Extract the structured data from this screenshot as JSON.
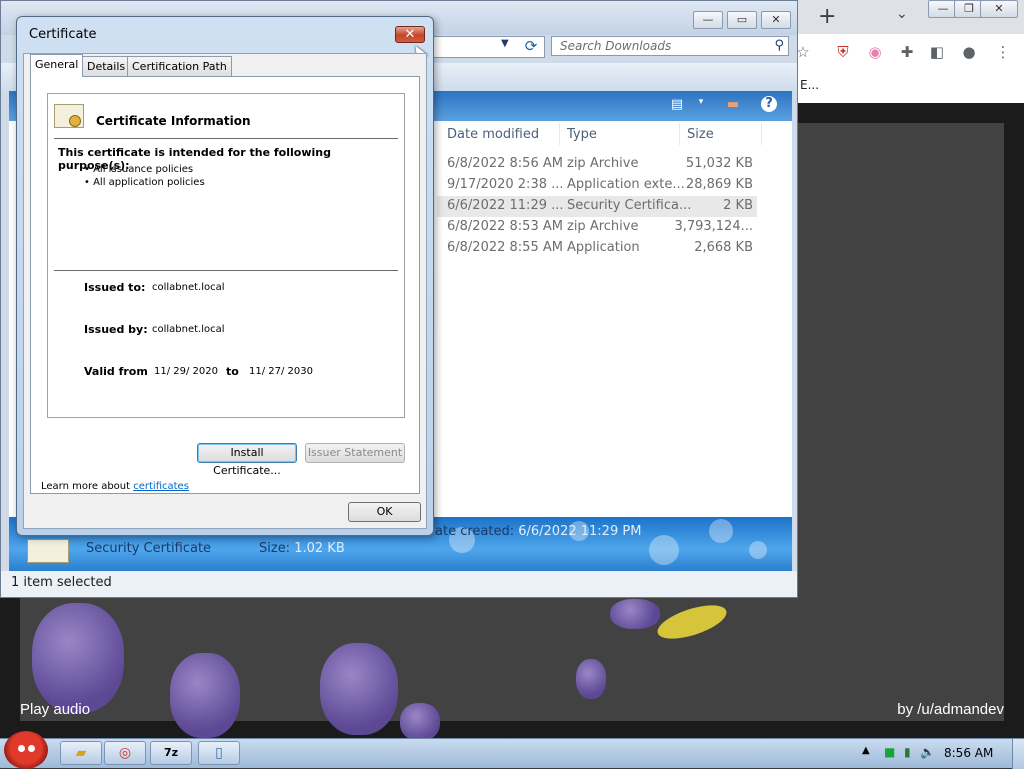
{
  "video": {
    "play_label": "Play audio",
    "credit": "by /u/admandev"
  },
  "browser": {
    "new_tab_glyph": "+",
    "tabs_dropdown_glyph": "⌄",
    "bookmark_fragment": "E..."
  },
  "explorer": {
    "search_placeholder": "Search Downloads",
    "columns": [
      "Date modified",
      "Type",
      "Size"
    ],
    "rows": [
      {
        "date": "6/8/2022 8:56 AM",
        "type": "zip Archive",
        "size": "51,032 KB"
      },
      {
        "date": "9/17/2020 2:38 ...",
        "type": "Application exte...",
        "size": "28,869 KB"
      },
      {
        "date": "6/6/2022 11:29 ...",
        "type": "Security Certifica...",
        "size": "2 KB"
      },
      {
        "date": "6/8/2022 8:53 AM",
        "type": "zip Archive",
        "size": "3,793,124..."
      },
      {
        "date": "6/8/2022 8:55 AM",
        "type": "Application",
        "size": "2,668 KB"
      }
    ],
    "details": {
      "name": "Security Certificate",
      "size_label": "Size:",
      "size_value": "1.02 KB",
      "date_label": "ate created:",
      "date_value": "6/6/2022 11:29 PM"
    },
    "status": "1 item selected"
  },
  "cert": {
    "title": "Certificate",
    "tabs": [
      "General",
      "Details",
      "Certification Path"
    ],
    "info_title": "Certificate Information",
    "purpose_heading": "This certificate is intended for the following purpose(s):",
    "purposes": [
      "• All issuance policies",
      "• All application policies"
    ],
    "issued_to_label": "Issued to:",
    "issued_to": "collabnet.local",
    "issued_by_label": "Issued by:",
    "issued_by": "collabnet.local",
    "valid_from_label": "Valid from",
    "valid_from": "11/ 29/ 2020",
    "to_label": "to",
    "valid_to": "11/ 27/ 2030",
    "install_button": "Install Certificate...",
    "issuer_button": "Issuer Statement",
    "learn_more": "Learn more about",
    "learn_link": "certificates",
    "ok_button": "OK"
  },
  "taskbar": {
    "clock": "8:56 AM",
    "app_7z": "7z"
  },
  "colors": {
    "detail_gradient": "#1c73c9",
    "close_red": "#c4462a",
    "link": "#0066cc"
  }
}
